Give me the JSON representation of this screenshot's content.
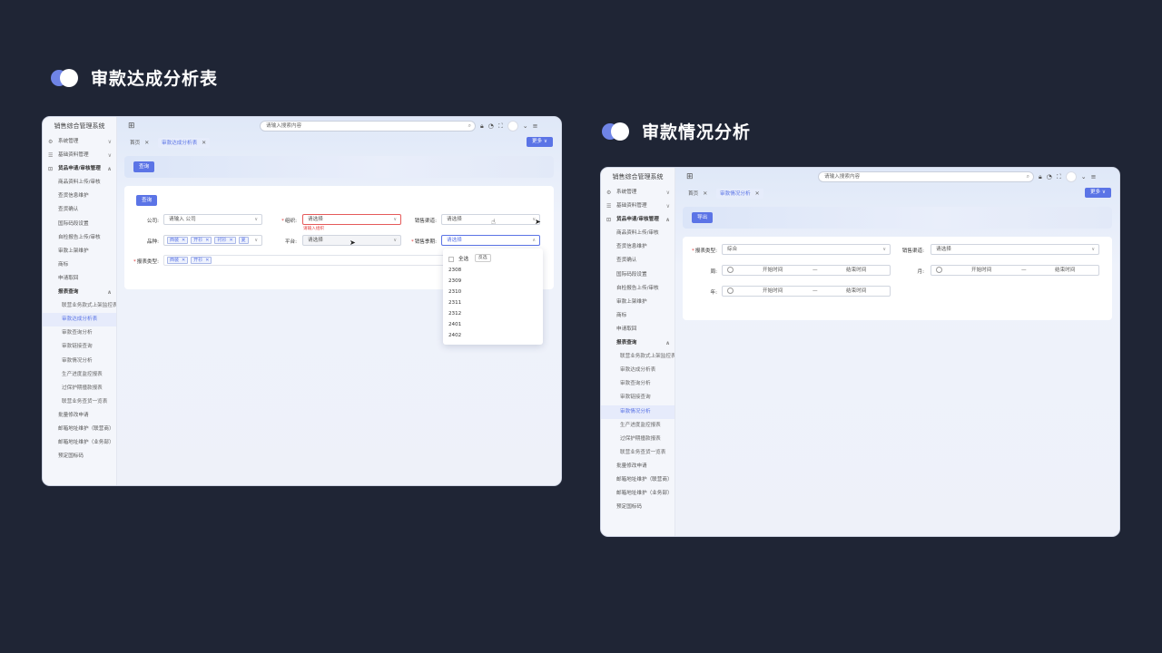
{
  "headings": {
    "left": "审款达成分析表",
    "right": "审款情况分析"
  },
  "app_title": "销售综合管理系统",
  "search_placeholder": "请输入搜索内容",
  "nav": [
    {
      "label": "系统管理",
      "icon": "gear-icon",
      "level": "top",
      "chev": "v"
    },
    {
      "label": "基础资料管理",
      "icon": "list-icon",
      "level": "top",
      "chev": "v"
    },
    {
      "label": "货品申请/审核管理",
      "icon": "cart-icon",
      "level": "top",
      "chev": "^"
    },
    {
      "label": "商品资料上传/审核",
      "level": "sub"
    },
    {
      "label": "查货信息维护",
      "level": "sub"
    },
    {
      "label": "查货确认",
      "level": "sub"
    },
    {
      "label": "国际码段设置",
      "level": "sub"
    },
    {
      "label": "自检报告上传/审核",
      "level": "sub"
    },
    {
      "label": "审款上架维护",
      "level": "sub"
    },
    {
      "label": "商标",
      "level": "sub"
    },
    {
      "label": "申请取回",
      "level": "sub"
    },
    {
      "label": "报表查询",
      "level": "group",
      "chev": "^"
    },
    {
      "label": "联营业务款式上架监控表",
      "level": "deep"
    },
    {
      "label": "审款达成分析表",
      "level": "deep"
    },
    {
      "label": "审款查询分析",
      "level": "deep"
    },
    {
      "label": "审款链接查询",
      "level": "deep"
    },
    {
      "label": "审款情况分析",
      "level": "deep"
    },
    {
      "label": "生产进度监控报表",
      "level": "deep"
    },
    {
      "label": "过保护期撞款报表",
      "level": "deep"
    },
    {
      "label": "联营业务查货一览表",
      "level": "deep"
    },
    {
      "label": "批量修改申请",
      "level": "sub"
    },
    {
      "label": "邮箱地址维护（联营商）",
      "level": "sub"
    },
    {
      "label": "邮箱地址维护（业务部）",
      "level": "sub"
    },
    {
      "label": "预定国标码",
      "level": "sub"
    }
  ],
  "tabs": {
    "home": "首页",
    "close": "✕",
    "left_active": "审款达成分析表",
    "right_active": "审款情况分析"
  },
  "more_label": "更多 ∨",
  "left": {
    "query_btn": "查询",
    "inner_query_btn": "查询",
    "company_label": "公司:",
    "company_placeholder": "请输入 公司",
    "org_label": "组织:",
    "org_value": "请选择",
    "org_error": "请输入组织",
    "channel_label": "销售渠道:",
    "channel_value": "请选择",
    "variety_label": "品种:",
    "variety_tags": [
      "西装",
      "开衫",
      "衬衫",
      "夏"
    ],
    "platform_label": "平台:",
    "platform_value": "请选择",
    "season_label": "销售季期:",
    "season_value": "请选择",
    "report_type_label": "报表类型:",
    "report_tags": [
      "西装",
      "开衫"
    ],
    "dropdown": {
      "select_all": "全选",
      "invert": "反选",
      "options": [
        "2308",
        "2309",
        "2310",
        "2311",
        "2312",
        "2401",
        "2402"
      ]
    }
  },
  "right": {
    "export_btn": "导出",
    "report_type_label": "报表类型:",
    "report_type_value": "综合",
    "channel_label": "销售渠道:",
    "channel_value": "请选择",
    "week_label": "周:",
    "month_label": "月:",
    "year_label": "年:",
    "start": "开始时间",
    "end": "结束时间",
    "dash": "—"
  },
  "colors": {
    "accent": "#5b74e6",
    "error": "#e23c3c",
    "background": "#1f2535"
  }
}
